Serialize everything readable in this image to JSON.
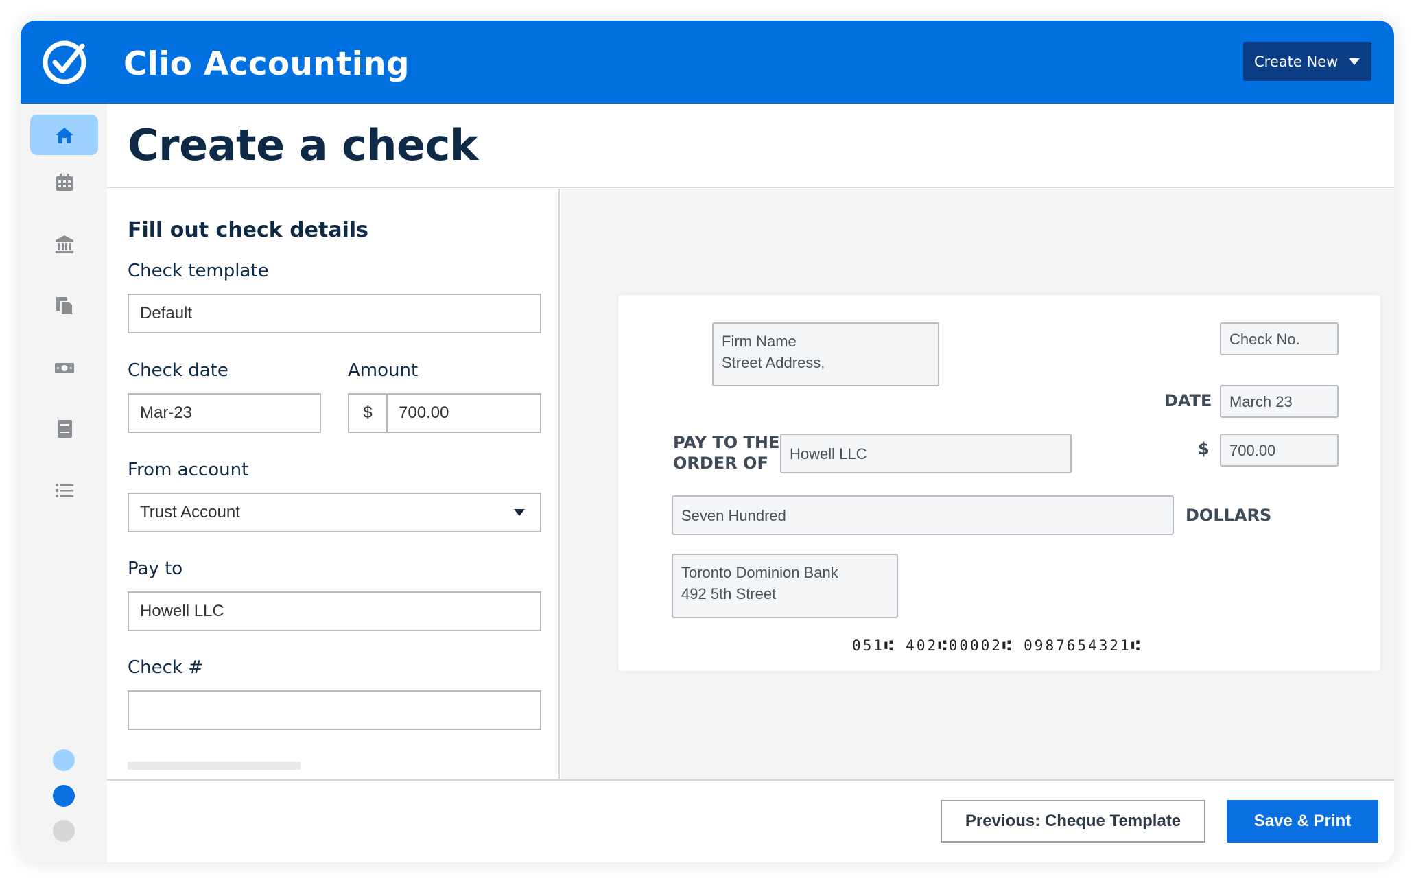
{
  "app": {
    "title": "Clio Accounting"
  },
  "header": {
    "create_new_label": "Create New"
  },
  "page": {
    "title": "Create a check"
  },
  "form": {
    "section_title": "Fill out check details",
    "check_template": {
      "label": "Check template",
      "value": "Default"
    },
    "check_date": {
      "label": "Check date",
      "value": "Mar-23"
    },
    "amount": {
      "label": "Amount",
      "prefix": "$",
      "value": "700.00"
    },
    "from_account": {
      "label": "From account",
      "value": "Trust Account"
    },
    "pay_to": {
      "label": "Pay to",
      "value": "Howell LLC"
    },
    "check_number": {
      "label": "Check #",
      "value": ""
    }
  },
  "check_preview": {
    "firm_name": "Firm Name",
    "street_address": "Street Address,",
    "check_no_placeholder": "Check No.",
    "date_label": "DATE",
    "date_value": "March 23",
    "pay_to_label_line1": "PAY TO THE",
    "pay_to_label_line2": "ORDER OF",
    "payee": "Howell LLC",
    "dollar_sign": "$",
    "amount": "700.00",
    "amount_words": "Seven Hundred",
    "dollars_label": "DOLLARS",
    "bank_name": "Toronto Dominion Bank",
    "bank_address": "492 5th Street",
    "micr_line": "051⑆ 402⑆00002⑆ 0987654321⑆"
  },
  "footer": {
    "previous_label": "Previous: Cheque Template",
    "save_label": "Save & Print"
  },
  "sidebar": {
    "items": [
      {
        "icon": "home-icon"
      },
      {
        "icon": "calendar-icon"
      },
      {
        "icon": "bank-icon"
      },
      {
        "icon": "documents-icon"
      },
      {
        "icon": "money-icon"
      },
      {
        "icon": "book-icon"
      },
      {
        "icon": "list-icon"
      }
    ],
    "step_dots": [
      "#9dd1ff",
      "#0a6fe0",
      "#d6d6d8"
    ]
  },
  "colors": {
    "brand": "#0070e0",
    "dark_button": "#0b3d84",
    "primary_button": "#0a6fe0"
  }
}
